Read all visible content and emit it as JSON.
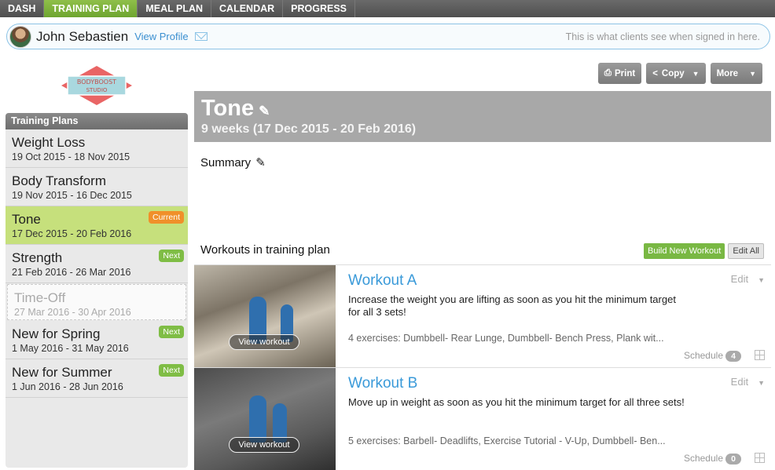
{
  "nav": {
    "tabs": [
      "DASH",
      "TRAINING PLAN",
      "MEAL PLAN",
      "CALENDAR",
      "PROGRESS"
    ],
    "active": 1
  },
  "client": {
    "name": "John Sebastien",
    "view_profile": "View Profile",
    "note": "This is what clients see when signed in here."
  },
  "logo": {
    "line1": "BODYBOOST",
    "line2": "STUDIO",
    "colors": {
      "diamond": "#e96565",
      "band": "#a9d8df"
    }
  },
  "sidebar": {
    "header": "Training Plans",
    "plans": [
      {
        "name": "Weight Loss",
        "dates": "19 Oct 2015 - 18 Nov 2015",
        "badge": ""
      },
      {
        "name": "Body Transform",
        "dates": "19 Nov 2015 - 16 Dec 2015",
        "badge": ""
      },
      {
        "name": "Tone",
        "dates": "17 Dec 2015 - 20 Feb 2016",
        "badge": "Current"
      },
      {
        "name": "Strength",
        "dates": "21 Feb 2016 - 26 Mar 2016",
        "badge": "Next"
      },
      {
        "name": "Time-Off",
        "dates": "27 Mar 2016 - 30 Apr 2016",
        "badge": ""
      },
      {
        "name": "New for Spring",
        "dates": "1 May 2016 - 31 May 2016",
        "badge": "Next"
      },
      {
        "name": "New for Summer",
        "dates": "1 Jun 2016 - 28 Jun 2016",
        "badge": "Next"
      }
    ]
  },
  "toolbar": {
    "print": "Print",
    "copy": "Copy",
    "more": "More"
  },
  "plan": {
    "title": "Tone",
    "duration": "9 weeks (17 Dec 2015 - 20 Feb 2016)",
    "summary_label": "Summary"
  },
  "workouts": {
    "heading": "Workouts in training plan",
    "build_new": "Build New Workout",
    "edit_all": "Edit All",
    "items": [
      {
        "name": "Workout A",
        "description": "Increase the weight you are lifting as soon as you hit the minimum target for all 3 sets!",
        "exercises": "4 exercises: Dumbbell- Rear Lunge, Dumbbell- Bench Press, Plank wit...",
        "view": "View workout",
        "edit": "Edit",
        "schedule": "Schedule",
        "count": "4"
      },
      {
        "name": "Workout B",
        "description": "Move up in weight as soon as you hit the minimum target for all three sets!",
        "exercises": "5 exercises: Barbell- Deadlifts, Exercise Tutorial - V-Up, Dumbbell- Ben...",
        "view": "View workout",
        "edit": "Edit",
        "schedule": "Schedule",
        "count": "0"
      }
    ]
  },
  "colors": {
    "accent_green": "#79b843",
    "link_blue": "#3a9ad9",
    "badge_orange": "#f0902a"
  }
}
